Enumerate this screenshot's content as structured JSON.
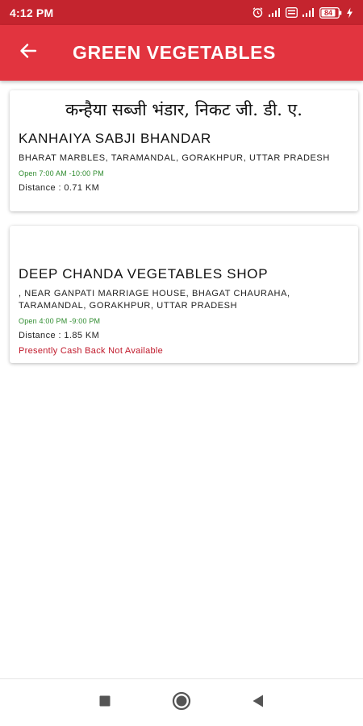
{
  "status_bar": {
    "time": "4:12 PM",
    "battery": "84",
    "icons": [
      "alarm-icon",
      "signal-icon",
      "volte-icon",
      "signal-icon",
      "battery-icon",
      "charging-icon"
    ]
  },
  "app_bar": {
    "title": "GREEN VEGETABLES",
    "back_icon": "arrow-left-icon"
  },
  "shops": [
    {
      "banner_text": "कन्हैया सब्जी भंडार, निकट जी. डी. ए.",
      "name": "KANHAIYA SABJI BHANDAR",
      "address": "BHARAT MARBLES, TARAMANDAL, GORAKHPUR, UTTAR PRADESH",
      "hours": "Open 7:00 AM -10:00 PM",
      "distance": "Distance : 0.71 KM"
    },
    {
      "name": "DEEP CHANDA VEGETABLES SHOP",
      "address": ", NEAR GANPATI MARRIAGE HOUSE, BHAGAT CHAURAHA, TARAMANDAL, GORAKHPUR, UTTAR PRADESH",
      "hours": "Open 4:00 PM -9:00 PM",
      "distance": "Distance : 1.85 KM",
      "cashback_note": "Presently Cash Back Not Available"
    }
  ],
  "nav_bar": {
    "buttons": [
      "recents-square-icon",
      "home-circle-icon",
      "back-triangle-icon"
    ]
  },
  "colors": {
    "status_bar": "#c4242e",
    "app_bar": "#e2343f",
    "hours_text": "#2e8b2e",
    "cashback_text": "#c0182a"
  }
}
